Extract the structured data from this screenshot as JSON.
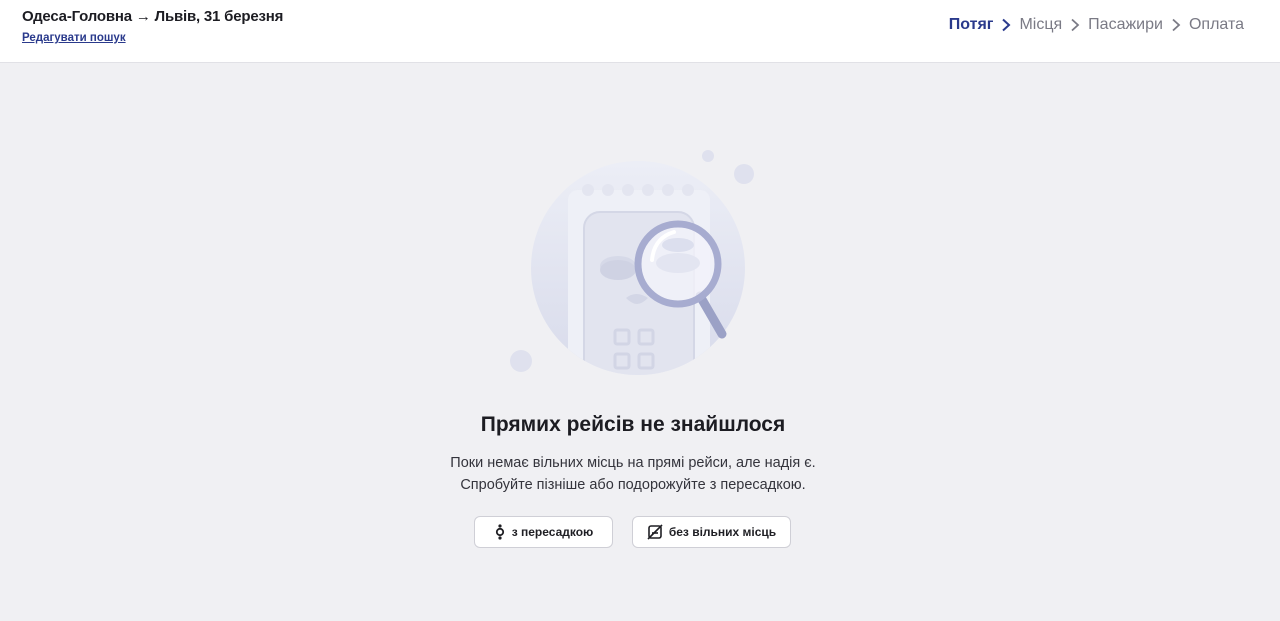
{
  "header": {
    "route": "Одеса-Головна → Львів, 31 березня",
    "edit_link": "Редагувати пошук"
  },
  "steps": [
    {
      "label": "Потяг",
      "active": true
    },
    {
      "label": "Місця",
      "active": false
    },
    {
      "label": "Пасажири",
      "active": false
    },
    {
      "label": "Оплата",
      "active": false
    }
  ],
  "empty_state": {
    "title": "Прямих рейсів не знайшлося",
    "line1": "Поки немає вільних місць на прямі рейси, але надія є.",
    "line2": "Спробуйте пізніше або подорожуйте з пересадкою."
  },
  "buttons": {
    "transfer": "з пересадкою",
    "no_seats": "без вільних місць"
  },
  "colors": {
    "accent": "#2a3a8c",
    "background": "#f0f0f3",
    "illustration_circle": "#dfe1ef"
  },
  "icons": {
    "transfer": "transfer-stop-icon",
    "no_seats": "seat-crossed-icon",
    "step_separator": "chevron-right-icon"
  }
}
